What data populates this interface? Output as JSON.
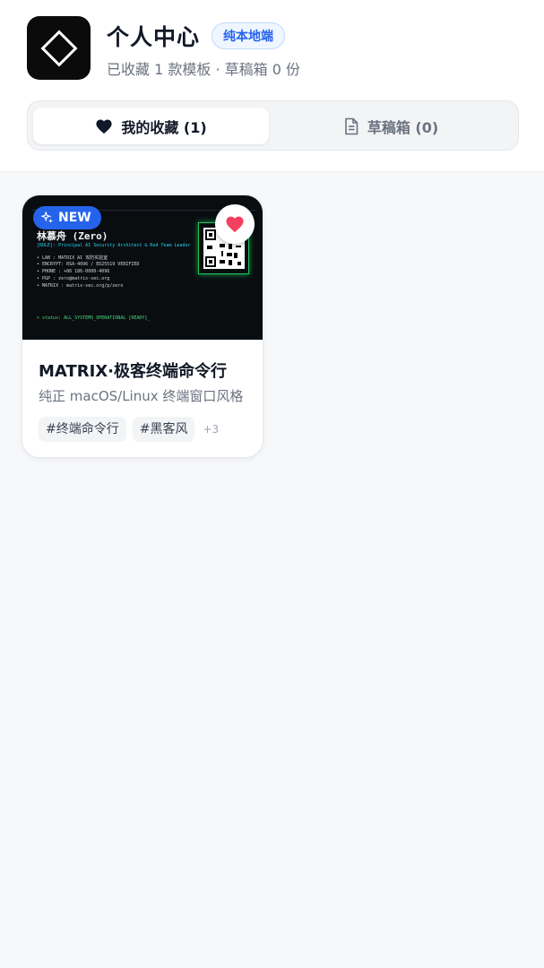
{
  "header": {
    "title": "个人中心",
    "badge": "纯本地端",
    "subtitle": "已收藏 1 款模板 · 草稿箱 0 份"
  },
  "tabs": [
    {
      "label": "我的收藏 (1)",
      "active": true,
      "icon": "heart-icon"
    },
    {
      "label": "草稿箱 (0)",
      "active": false,
      "icon": "document-icon"
    }
  ],
  "cards": [
    {
      "badge": "NEW",
      "favorited": true,
      "title": "MATRIX·极客终端命令行",
      "description": "纯正 macOS/Linux 终端窗口风格",
      "tags": [
        "#终端命令行",
        "#黑客风"
      ],
      "more": "+3",
      "preview": {
        "name": "林慕舟 (Zero)",
        "role": "[ROLE]: Principal AI Security Architect & Red Team Leader",
        "lines": [
          "• LAB : MATRIX AI 攻防实验室",
          "• ENCRYPT: RSA-4096 / ED25519 VERIFIED",
          "• PHONE : +86 186-0000-4096",
          "• PGP : zero@matrix-sec.org",
          "• MATRIX : matrix-sec.org/p/zero"
        ],
        "status": "> status: ALL_SYSTEMS_OPERATIONAL [READY]_"
      }
    }
  ],
  "colors": {
    "accent": "#2563eb",
    "heart": "#f43f5e",
    "terminal_green": "#4ade80"
  }
}
